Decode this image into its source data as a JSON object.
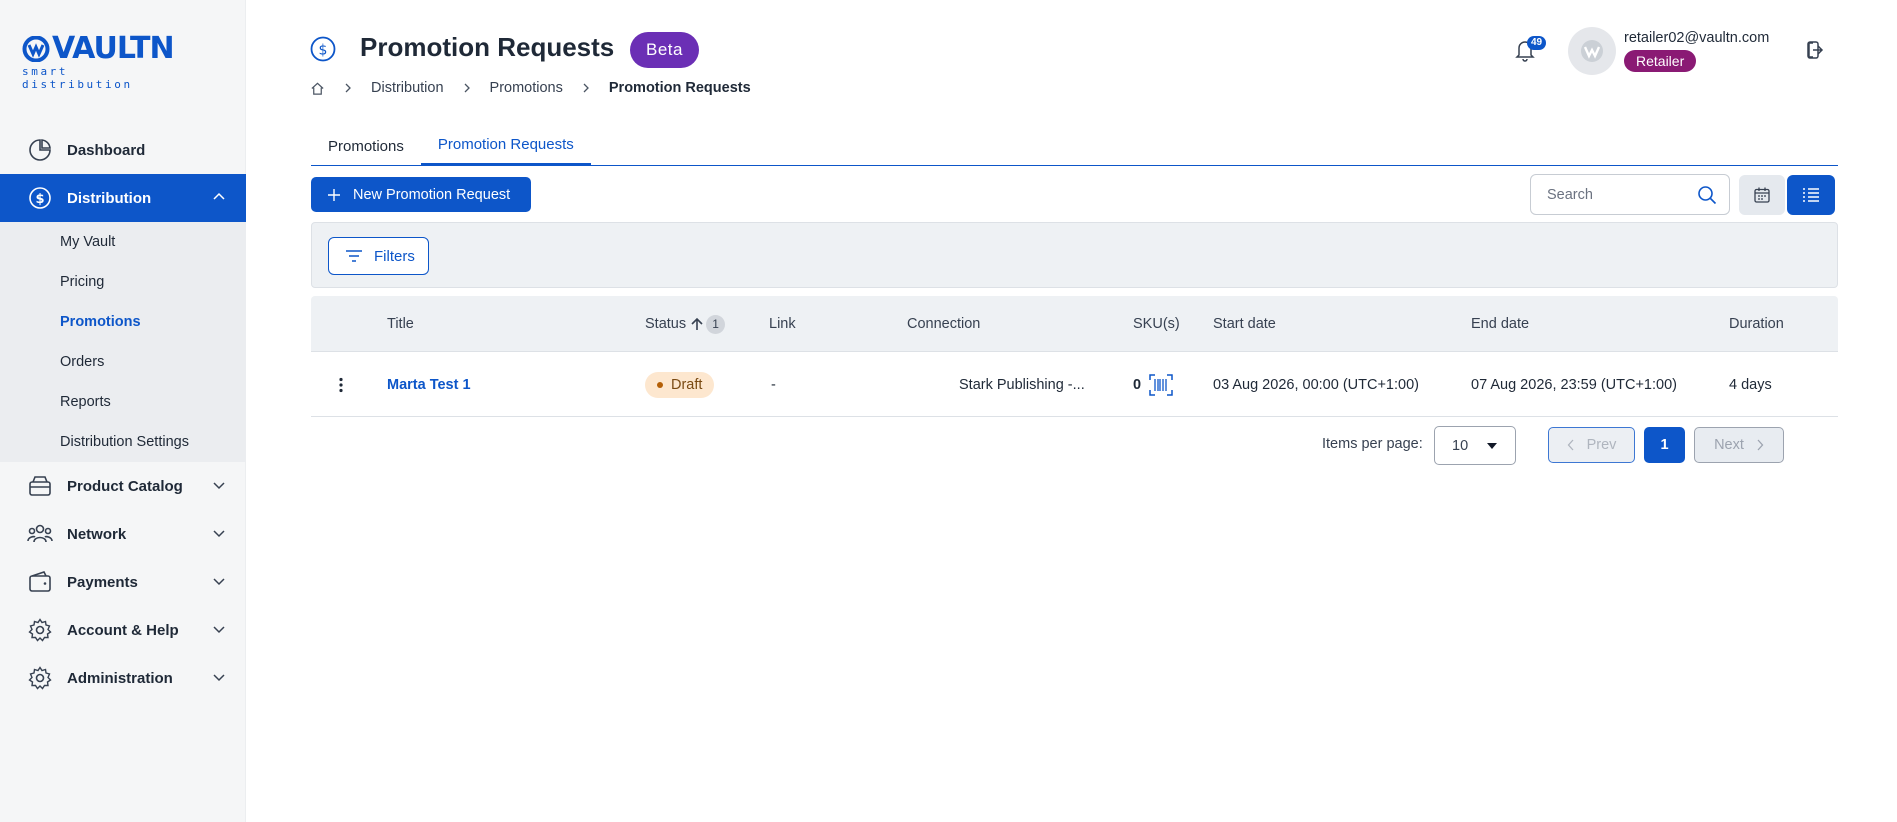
{
  "brand": {
    "name": "VAULTN",
    "tagline": "smart distribution",
    "color": "#0d56c9"
  },
  "sidebar": {
    "items": [
      {
        "label": "Dashboard",
        "icon": "dashboard-chart-icon",
        "expanded": false
      },
      {
        "label": "Distribution",
        "icon": "dollar-circle-icon",
        "expanded": true,
        "active": true
      },
      {
        "label": "Product Catalog",
        "icon": "box-icon",
        "expanded": false
      },
      {
        "label": "Network",
        "icon": "people-network-icon",
        "expanded": false
      },
      {
        "label": "Payments",
        "icon": "wallet-icon",
        "expanded": false
      },
      {
        "label": "Account & Help",
        "icon": "gear-icon",
        "expanded": false
      },
      {
        "label": "Administration",
        "icon": "gear-icon",
        "expanded": false
      }
    ],
    "distribution_sub": [
      {
        "label": "My Vault",
        "active": false
      },
      {
        "label": "Pricing",
        "active": false
      },
      {
        "label": "Promotions",
        "active": true
      },
      {
        "label": "Orders",
        "active": false
      },
      {
        "label": "Reports",
        "active": false
      },
      {
        "label": "Distribution Settings",
        "active": false
      }
    ]
  },
  "header": {
    "title": "Promotion Requests",
    "badge": "Beta",
    "breadcrumb": [
      "Distribution",
      "Promotions",
      "Promotion Requests"
    ],
    "notifications_count": "49",
    "user_email": "retailer02@vaultn.com",
    "user_role": "Retailer"
  },
  "tabs": [
    {
      "label": "Promotions",
      "active": false
    },
    {
      "label": "Promotion Requests",
      "active": true
    }
  ],
  "toolbar": {
    "new_button": "New Promotion Request",
    "search_placeholder": "Search",
    "filters_button": "Filters"
  },
  "table": {
    "columns": [
      "Title",
      "Status",
      "Link",
      "Connection",
      "SKU(s)",
      "Start date",
      "End date",
      "Duration"
    ],
    "sort": {
      "column": "Status",
      "direction": "asc",
      "count": "1"
    },
    "rows": [
      {
        "title": "Marta Test 1",
        "status": "Draft",
        "link": "-",
        "connection": "Stark Publishing -...",
        "skus": "0",
        "start_date": "03 Aug 2026, 00:00 (UTC+1:00)",
        "end_date": "07 Aug 2026, 23:59 (UTC+1:00)",
        "duration": "4 days"
      }
    ]
  },
  "pagination": {
    "items_per_page_label": "Items per page:",
    "items_per_page": "10",
    "prev": "Prev",
    "current_page": "1",
    "next": "Next"
  }
}
